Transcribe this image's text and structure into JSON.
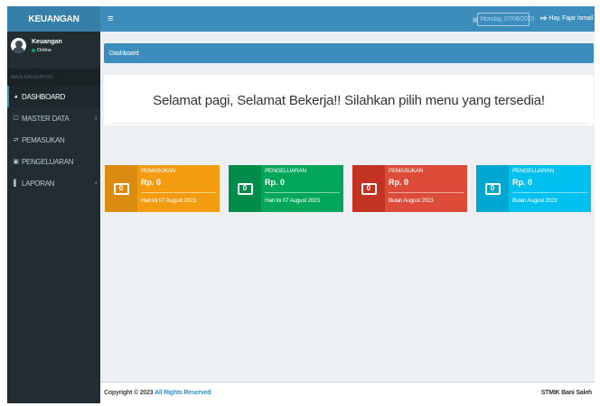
{
  "app": {
    "logo": "KEUANGAN"
  },
  "navbar": {
    "menu_icon": "≡",
    "date": "Monday, 07/08/2023",
    "greeting": "Hay, Fajar Ismail"
  },
  "user": {
    "name": "Keuangan",
    "status": "Online"
  },
  "sidebar": {
    "header": "MAIN NAVIGATION",
    "items": [
      {
        "label": "DASHBOARD",
        "icon": "dashboard-icon"
      },
      {
        "label": "MASTER DATA",
        "icon": "folder-icon"
      },
      {
        "label": "PEMASUKAN",
        "icon": "exchange-icon"
      },
      {
        "label": "PENGELUARAN",
        "icon": "money-icon"
      },
      {
        "label": "LAPORAN",
        "icon": "book-icon"
      }
    ]
  },
  "content": {
    "breadcrumb": "Dashboard",
    "welcome": "Selamat pagi, Selamat Bekerja!! Silahkan pilih menu yang tersedia!",
    "cards": [
      {
        "label": "PEMASUKAN",
        "value": "Rp. 0",
        "desc": "Hari Ini 07 August 2023",
        "color": "#f39c12",
        "dark": "#da8c10"
      },
      {
        "label": "PENGELUARAN",
        "value": "Rp. 0",
        "desc": "Hari Ini 07 August 2023",
        "color": "#00a65a",
        "dark": "#008d4c"
      },
      {
        "label": "PEMASUKAN",
        "value": "Rp. 0",
        "desc": "Bulan August 2023",
        "color": "#dd4b39",
        "dark": "#c23321"
      },
      {
        "label": "PENGELUARAN",
        "value": "Rp. 0",
        "desc": "Bulan August 2023",
        "color": "#00c0ef",
        "dark": "#00a7d0"
      }
    ]
  },
  "footer": {
    "copy_prefix": "Copyright © 2023",
    "copy_link": "All Rights Reserved",
    "brand": "STMIK Bani Saleh"
  }
}
